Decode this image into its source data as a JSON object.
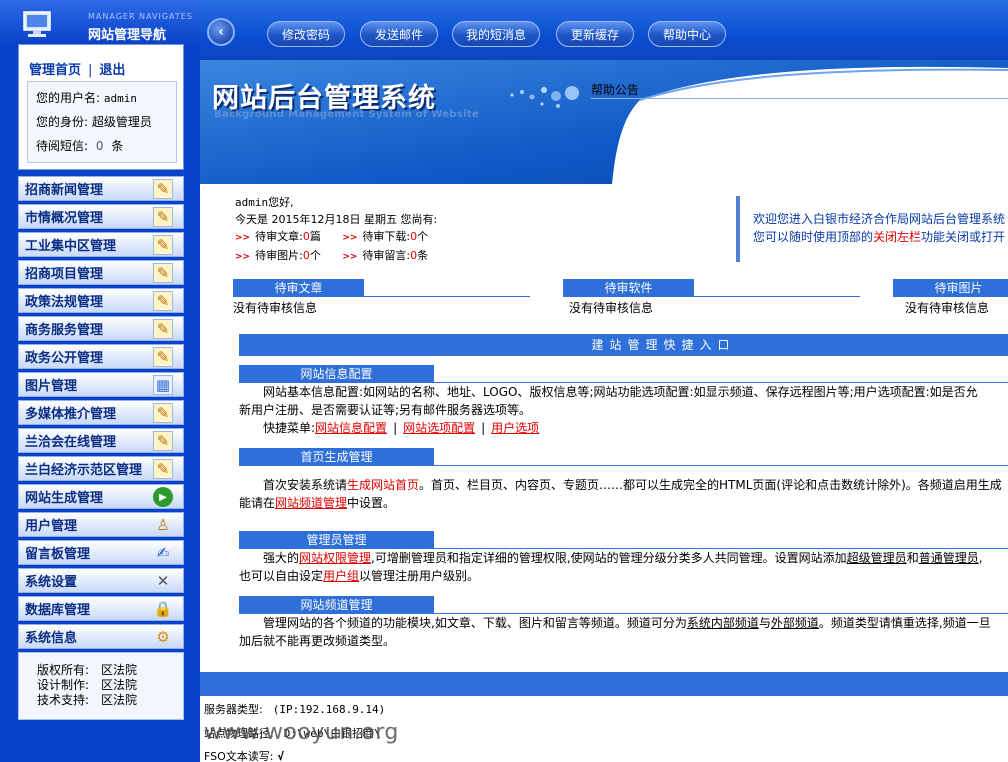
{
  "sidebar": {
    "brand_en": "MANAGER NAVIGATES",
    "brand_cn": "网站管理导航",
    "home_link": "管理首页",
    "separator": "|",
    "logout_link": "退出",
    "username_label": "您的用户名:",
    "username": "admin",
    "role_label": "您的身份:",
    "role": "超级管理员",
    "sms_label": "待阅短信:",
    "sms_count": "0",
    "sms_unit": "条",
    "menu": [
      {
        "label": "招商新闻管理",
        "icon": "edit-icon"
      },
      {
        "label": "市情概况管理",
        "icon": "edit-icon"
      },
      {
        "label": "工业集中区管理",
        "icon": "edit-icon"
      },
      {
        "label": "招商项目管理",
        "icon": "edit-icon"
      },
      {
        "label": "政策法规管理",
        "icon": "edit-icon"
      },
      {
        "label": "商务服务管理",
        "icon": "edit-icon"
      },
      {
        "label": "政务公开管理",
        "icon": "edit-icon"
      },
      {
        "label": "图片管理",
        "icon": "picture-icon"
      },
      {
        "label": "多媒体推介管理",
        "icon": "edit-icon"
      },
      {
        "label": "兰洽会在线管理",
        "icon": "edit-icon"
      },
      {
        "label": "兰白经济示范区管理",
        "icon": "edit-icon"
      },
      {
        "label": "网站生成管理",
        "icon": "play-icon"
      },
      {
        "label": "用户管理",
        "icon": "user-icon"
      },
      {
        "label": "留言板管理",
        "icon": "pen-icon"
      },
      {
        "label": "系统设置",
        "icon": "tools-icon"
      },
      {
        "label": "数据库管理",
        "icon": "lock-icon"
      },
      {
        "label": "系统信息",
        "icon": "gears-icon"
      }
    ],
    "copyright": [
      {
        "label": "版权所有:",
        "value": "区法院"
      },
      {
        "label": "设计制作:",
        "value": "区法院"
      },
      {
        "label": "技术支持:",
        "value": "区法院"
      }
    ]
  },
  "topbar": {
    "back_glyph": "‹",
    "buttons": [
      "修改密码",
      "发送邮件",
      "我的短消息",
      "更新缓存",
      "帮助中心"
    ]
  },
  "banner": {
    "title": "网站后台管理系统",
    "subtitle": "Background Management System of Website",
    "notice_title": "帮助公告"
  },
  "main": {
    "greeting_name": "admin",
    "greeting_suffix": "您好,",
    "today_line": "今天是  2015年12月18日  星期五  您尚有:",
    "pending_articles_label": "待审文章:",
    "pending_articles_count": "0",
    "pending_articles_unit": "篇",
    "pending_downloads_label": "待审下载:",
    "pending_downloads_count": "0",
    "pending_downloads_unit": "个",
    "pending_images_label": "待审图片:",
    "pending_images_count": "0",
    "pending_images_unit": "个",
    "pending_messages_label": "待审留言:",
    "pending_messages_count": "0",
    "pending_messages_unit": "条",
    "arrow_glyph": ">>",
    "welcome_line1": "欢迎您进入白银市经济合作局网站后台管理系统",
    "welcome_line2_a": "您可以随时使用顶部的",
    "welcome_line2_link": "关闭左栏",
    "welcome_line2_b": "功能关闭或打开",
    "pending_boxes": [
      {
        "title": "待审文章",
        "text": "没有待审核信息"
      },
      {
        "title": "待审软件",
        "text": "没有待审核信息"
      },
      {
        "title": "待审图片",
        "text": "没有待审核信息"
      }
    ],
    "quick_title": "建站管理快捷入口",
    "sections": {
      "info_config": {
        "title": "网站信息配置",
        "line1": "网站基本信息配置:如网站的名称、地址、LOGO、版权信息等;网站功能选项配置:如显示频道、保存远程图片等;用户选项配置:如是否允",
        "line2": "新用户注册、是否需要认证等;另有邮件服务器选项等。",
        "quick_label": "快捷菜单:",
        "links": [
          "网站信息配置",
          "网站选项配置",
          "用户选项"
        ]
      },
      "home_gen": {
        "title": "首页生成管理",
        "line1_a": "首次安装系统请",
        "line1_link": "生成网站首页",
        "line1_b": "。首页、栏目页、内容页、专题页……都可以生成完全的HTML页面(评论和点击数统计除外)。各频道启用生成",
        "line2_a": "能请在",
        "line2_link": "网站频道管理",
        "line2_b": "中设置。"
      },
      "admin_mgmt": {
        "title": "管理员管理",
        "line1_a": "强大的",
        "line1_link": "网站权限管理",
        "line1_b": ",可增删管理员和指定详细的管理权限,使网站的管理分级分类多人共同管理。设置网站添加",
        "line1_link2": "超级管理员",
        "line1_c": "和",
        "line1_link3": "普通管理员",
        "line1_d": ",",
        "line2_a": "也可以自由设定",
        "line2_link": "用户组",
        "line2_b": "以管理注册用户级别。"
      },
      "channel_mgmt": {
        "title": "网站频道管理",
        "line1_a": "管理网站的各个频道的功能模块,如文章、下载、图片和留言等频道。频道可分为",
        "line1_link": "系统内部频道",
        "line1_b": "与",
        "line1_link2": "外部频道",
        "line1_c": "。频道类型请慎重选择,频道一旦",
        "line2": "加后就不能再更改频道类型。"
      }
    }
  },
  "server": {
    "type_label": "服务器类型:",
    "type_value": "(IP:192.168.9.14)",
    "path_label": "站点物理路径:",
    "path_value": "D:\\web\\白银招商\\",
    "fso_label": "FSO文本读写:",
    "fso_value": "√"
  },
  "watermark": "www.wooyun.org",
  "colors": {
    "sidebar_bg": "#0a43c9",
    "accent": "#2f6fd9",
    "link_red": "#dd0000",
    "menu_text": "#0b2d84"
  }
}
